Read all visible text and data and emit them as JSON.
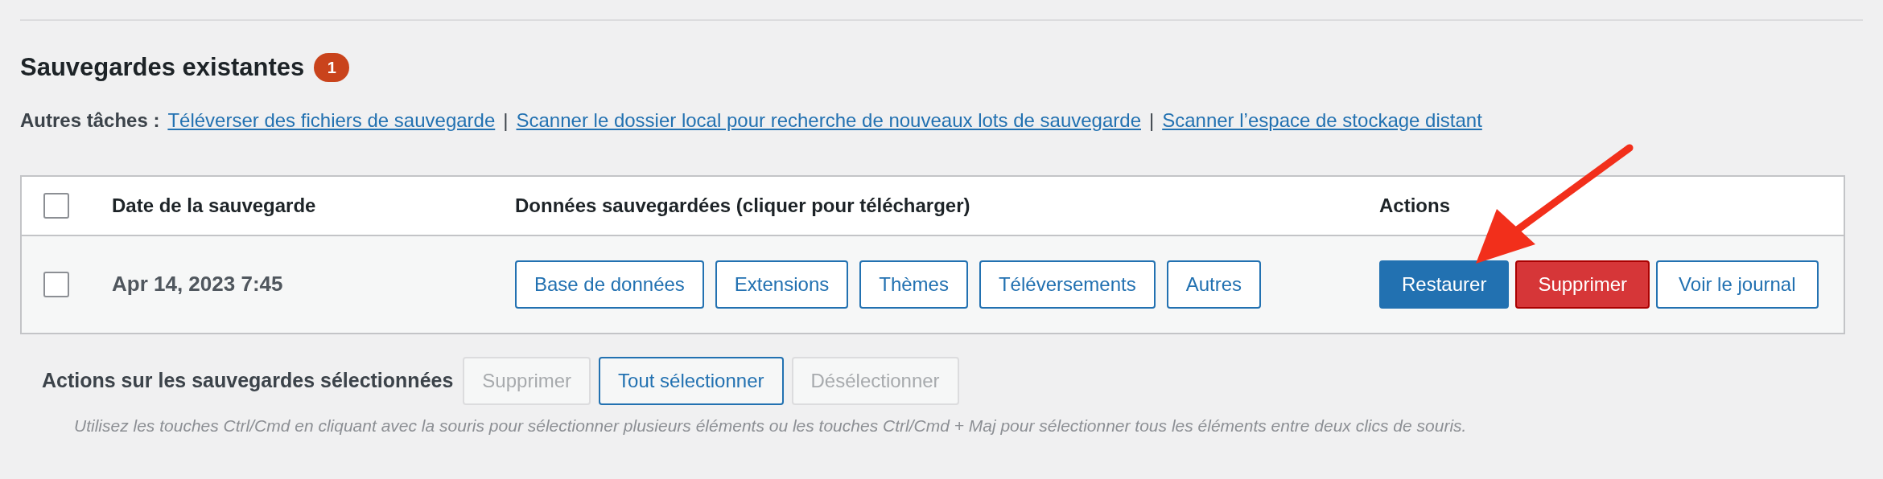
{
  "section": {
    "title": "Sauvegardes existantes",
    "count": "1"
  },
  "tasks": {
    "label": "Autres tâches :",
    "separator": "|",
    "links": [
      "Téléverser des fichiers de sauvegarde",
      "Scanner le dossier local pour recherche de nouveaux lots de sauvegarde",
      "Scanner l’espace de stockage distant"
    ]
  },
  "table": {
    "header_checked": false,
    "columns": [
      "Date de la sauvegarde",
      "Données sauvegardées (cliquer pour télécharger)",
      "Actions"
    ],
    "rows": [
      {
        "checked": false,
        "date": "Apr 14, 2023 7:45",
        "data_buttons": [
          "Base de données",
          "Extensions",
          "Thèmes",
          "Téléversements",
          "Autres"
        ],
        "actions": [
          {
            "label": "Restaurer",
            "kind": "primary"
          },
          {
            "label": "Supprimer",
            "kind": "danger"
          },
          {
            "label": "Voir le journal",
            "kind": "secondary"
          }
        ]
      }
    ]
  },
  "bulk": {
    "label": "Actions sur les sauvegardes sélectionnées",
    "buttons": [
      {
        "label": "Supprimer",
        "disabled": true
      },
      {
        "label": "Tout sélectionner",
        "disabled": false
      },
      {
        "label": "Désélectionner",
        "disabled": true
      }
    ],
    "hint": "Utilisez les touches Ctrl/Cmd en cliquant avec la souris pour sélectionner plusieurs éléments ou les touches Ctrl/Cmd + Maj pour sélectionner tous les éléments entre deux clics de souris."
  },
  "annotation": {
    "kind": "arrow"
  }
}
